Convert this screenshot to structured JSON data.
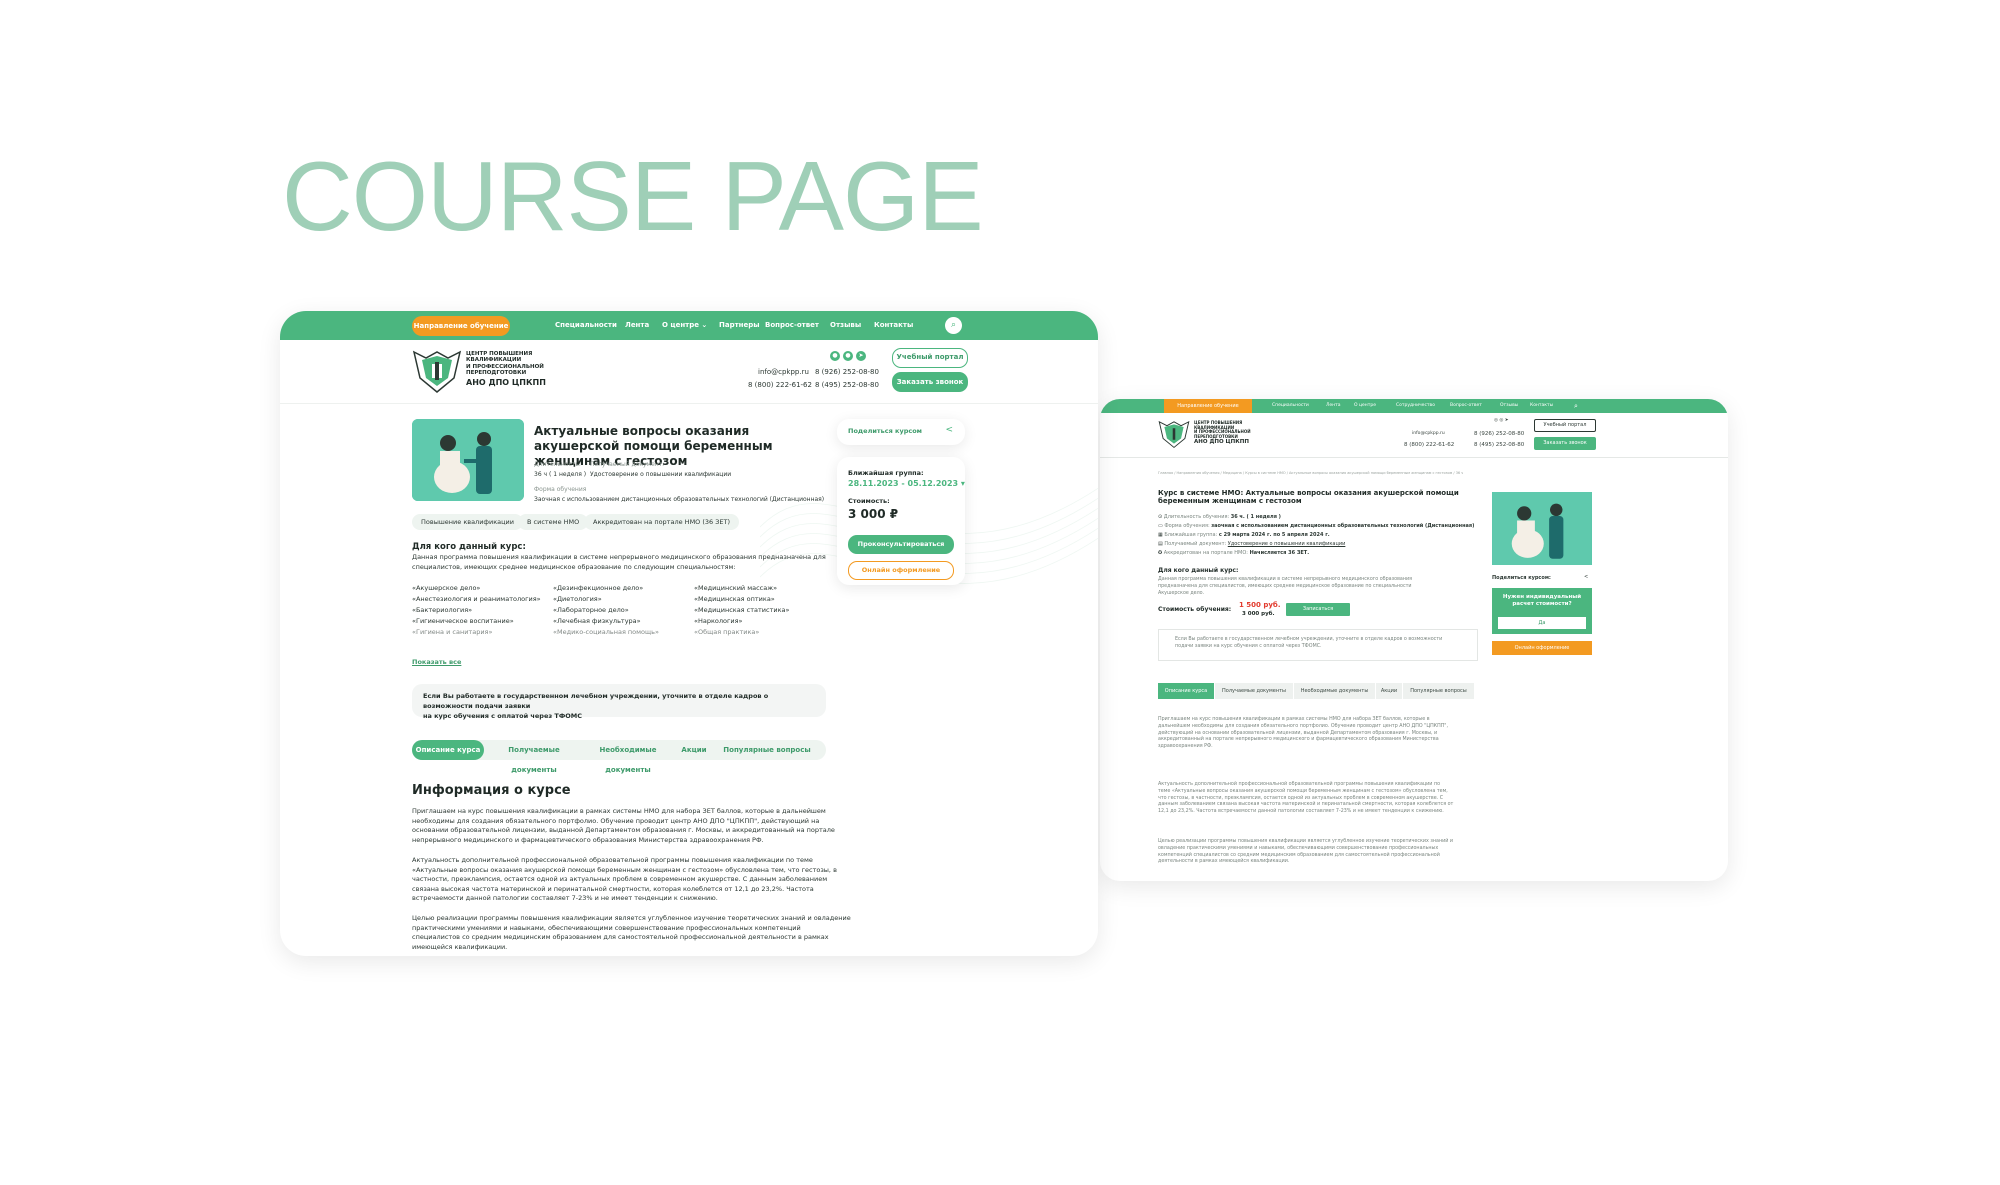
{
  "hero": {
    "title": "COURSE PAGE"
  },
  "desktop": {
    "nav": {
      "direction": "Направление обучение",
      "items": [
        "Специальности",
        "Лента",
        "О центре",
        "Партнеры",
        "Вопрос-ответ",
        "Отзывы",
        "Контакты"
      ]
    },
    "logo": {
      "line1": "ЦЕНТР ПОВЫШЕНИЯ",
      "line2": "КВАЛИФИКАЦИИ",
      "line3": "И ПРОФЕССИОНАЛЬНОЙ",
      "line4": "ПЕРЕПОДГОТОВКИ",
      "name": "АНО ДПО ЦПКПП"
    },
    "contacts": {
      "email": "info@cpkpp.ru",
      "phone1": "8 (926) 252-08-80",
      "phone_free": "8 (800) 222-61-62",
      "phone2": "8 (495) 252-08-80"
    },
    "buttons": {
      "portal": "Учебный портал",
      "callback": "Заказать звонок"
    },
    "course": {
      "title": "Актуальные вопросы оказания акушерской помощи беременным женщинам с гестозом",
      "duration_label": "Длительность:",
      "duration": "36 ч ( 1 неделя )",
      "doc_label": "Получаемый документ:",
      "doc": "Удостоверение о повышении квалификации",
      "form_label": "Форма обучения",
      "form": "Заочная с использованием дистанционных образовательных технологий (Дистанционная)",
      "tags": [
        "Повышение квалификации",
        "В системе НМО",
        "Аккредитован на портале НМО (36 ЗЕТ)"
      ]
    },
    "audience": {
      "heading": "Для кого данный курс:",
      "text1": "Данная программа повышения квалификации в системе непрерывного медицинского образования предназначена для",
      "text2": "специалистов, имеющих среднее медицинское образование по следующим специальностям:",
      "col1": [
        "«Акушерское дело»",
        "«Анестезиология и реаниматология»",
        "«Бактериология»",
        "«Гигиеническое воспитание»",
        "«Гигиена и санитария»"
      ],
      "col2": [
        "«Дезинфекционное дело»",
        "«Диетология»",
        "«Лабораторное дело»",
        "«Лечебная физкультура»",
        "«Медико-социальная помощь»"
      ],
      "col3": [
        "«Медицинский массаж»",
        "«Медицинская оптика»",
        "«Медицинская статистика»",
        "«Наркология»",
        "«Общая практика»"
      ],
      "show_all": "Показать все"
    },
    "notice": {
      "line1": "Если Вы работаете в государственном лечебном учреждении, уточните в отделе кадров о возможности подачи заявки",
      "line2": "на курс обучения с оплатой через ТФОМС"
    },
    "tabs": [
      "Описание курса",
      "Получаемые документы",
      "Необходимые документы",
      "Акции",
      "Популярные вопросы"
    ],
    "info": {
      "heading": "Информация о курсе",
      "p1": [
        "Приглашаем на курс повышения квалификации в рамках системы НМО для набора ЗЕТ баллов, которые в дальнейшем",
        "необходимы для создания обязательного портфолио. Обучение проводит центр АНО ДПО \"ЦПКПП\", действующий на",
        "основании образовательной лицензии, выданной Департаментом образования г. Москвы, и аккредитованный на портале",
        "непрерывного медицинского и фармацевтического образования Министерства здравоохранения РФ."
      ],
      "p2": [
        "Актуальность дополнительной профессиональной образовательной программы повышения квалификации по теме",
        "«Актуальные вопросы оказания акушерской помощи беременным женщинам с гестозом» обусловлена тем, что  гестозы, в",
        "частности, преэклампсия, остается одной из актуальных проблем в современном акушерстве. С данным заболеванием",
        "связана высокая частота материнской и перинатальной смертности, которая колеблется от 12,1 до 23,2%. Частота",
        "встречаемости данной патологии составляет 7-23% и не имеет тенденции к снижению."
      ],
      "p3": [
        "Целью реализации программы повышения квалификации является углубленное изучение теоретических знаний и овладение",
        "практическими умениями и навыками, обеспечивающими совершенствование профессиональных компетенций",
        "специалистов со средним медицинским образованием для самостоятельной профессиональной деятельности в рамках",
        "имеющейся квалификации."
      ]
    },
    "side": {
      "share": "Поделиться курсом",
      "nearest": "Ближайшая группа:",
      "dates": "28.11.2023 - 05.12.2023",
      "cost_label": "Стоимость:",
      "cost": "3 000 ₽",
      "consult": "Проконсультироваться",
      "online": "Онлайн оформление"
    }
  },
  "legacy": {
    "nav": {
      "direction": "Направление обучение",
      "items": [
        "Специальности",
        "Лента",
        "О центре",
        "Сотрудничество",
        "Вопрос-ответ",
        "Отзывы",
        "Контакты"
      ]
    },
    "contacts": {
      "email": "info@cpkpp.ru",
      "phone_free": "8 (800) 222-61-62",
      "phone1": "8 (926) 252-08-80",
      "phone2": "8 (495) 252-08-80"
    },
    "buttons": {
      "portal": "Учебный портал",
      "callback": "Заказать звонок"
    },
    "breadcrumb": "Главная / Направления обучения / Медицина / Курсы в системе НМО / Актуальные вопросы оказания акушерской помощи беременным женщинам с гестозом / 36 ч",
    "title1": "Курс в системе НМО: Актуальные вопросы оказания акушерской помощи",
    "title2": "беременным женщинам с гестозом",
    "facts": [
      {
        "label": "Длительность обучения:",
        "value": "36 ч. ( 1 неделя )"
      },
      {
        "label": "Форма обучения:",
        "value": "заочная с использованием дистанционных образовательных технологий (Дистанционная)"
      },
      {
        "label": "Ближайшая группа:",
        "value": "с 29 марта 2024 г. по 5 апреля 2024 г."
      },
      {
        "label": "Получаемый документ:",
        "value": "Удостоверение о повышении квалификации"
      },
      {
        "label": "Аккредитован на портале НМО:",
        "value": "Начисляется 36 ЗЕТ."
      }
    ],
    "audience_heading": "Для кого данный курс:",
    "audience_text": [
      "Данная программа повышения квалификации в системе непрерывного медицинского образования",
      "предназначена для специалистов, имеющих среднее медицинское образование по специальности",
      "Акушерское дело."
    ],
    "cost_label": "Стоимость обучения:",
    "price_new": "1 500 руб.",
    "price_old": "3 000 руб.",
    "enroll": "Записаться",
    "notice": [
      "Если Вы работаете в государственном лечебном учреждении, уточните в отделе кадров о возможности",
      "подачи заявки на курс обучения с оплатой через ТФОМС."
    ],
    "tabs": [
      "Описание курса",
      "Получаемые документы",
      "Необходимые документы",
      "Акции",
      "Популярные вопросы"
    ],
    "p1": [
      "Приглашаем на курс повышения квалификации в рамках системы НМО для набора ЗЕТ баллов, которые в",
      "дальнейшем необходимы для создания обязательного портфолио. Обучение проводит центр АНО ДПО \"ЦПКПП\",",
      "действующий на основании образовательной лицензии, выданной Департаментом образования г. Москвы, и",
      "аккредитованный на портале непрерывного медицинского и фармацевтического образования Министерства",
      "здравоохранения РФ."
    ],
    "p2": [
      "Актуальность дополнительной профессиональной образовательной программы повышения квалификации по",
      "теме «Актуальные вопросы оказания акушерской помощи беременным женщинам с гестозом» обусловлена тем,",
      "что  гестозы, в частности, преэклампсия, остается одной из актуальных проблем в современном акушерстве. С",
      "данным заболеванием связана высокая частота материнской и перинатальной смертности, которая колеблется от",
      "12,1 до 23,2%. Частота встречаемости данной патологии составляет 7-23% и не имеет тенденции к снижению."
    ],
    "p3": [
      "Целью реализации программы повышения квалификации является углубленное изучение теоретических знаний и",
      "овладение практическими умениями и навыками, обеспечивающими совершенствование профессиональных",
      "компетенций специалистов со средним медицинским образованием для самостоятельной профессиональной",
      "деятельности в рамках имеющейся квалификации."
    ],
    "share": "Поделиться курсом:",
    "calc": {
      "q1": "Нужен индивидуальный",
      "q2": "расчет стоимости?",
      "yes": "Да"
    },
    "online": "Онлайн оформление"
  }
}
